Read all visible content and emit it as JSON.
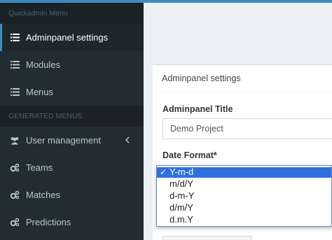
{
  "sidebar": {
    "header": "Quickadmin Menu",
    "items": [
      {
        "label": "Adminpanel settings",
        "icon": "list-icon",
        "active": true
      },
      {
        "label": "Modules",
        "icon": "list-icon"
      },
      {
        "label": "Menus",
        "icon": "list-icon"
      }
    ],
    "generated_header": "GENERATED MENUS",
    "generated_items": [
      {
        "label": "User management",
        "icon": "users-icon"
      },
      {
        "label": "Teams",
        "icon": "gears-icon"
      },
      {
        "label": "Matches",
        "icon": "gears-icon"
      },
      {
        "label": "Predictions",
        "icon": "gears-icon"
      }
    ]
  },
  "panel": {
    "title": "Adminpanel settings",
    "title_field_label": "Adminpanel Title",
    "title_field_value": "Demo Project",
    "date_format_label": "Date Format*"
  },
  "date_format_dropdown": {
    "options": [
      "Y-m-d",
      "m/d/Y",
      "d-m-Y",
      "d/m/Y",
      "d.m.Y"
    ],
    "selected": "Y-m-d",
    "check_glyph": "✓"
  },
  "colors": {
    "sidebar_bg": "#222d32",
    "accent": "#3c8dbc",
    "selection": "#2f6fde"
  }
}
